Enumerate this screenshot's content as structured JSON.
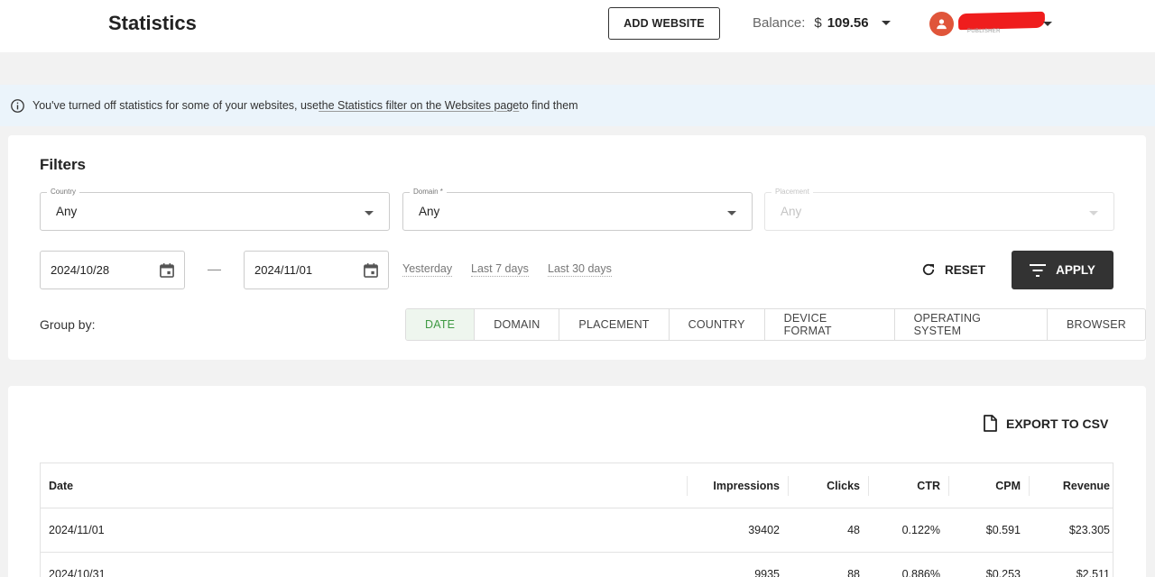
{
  "header": {
    "title": "Statistics",
    "add_website_label": "ADD WEBSITE",
    "balance_label": "Balance:",
    "balance_currency": "$",
    "balance_amount": "109.56",
    "account_role": "PUBLISHER",
    "avatar_color": "#e0553a"
  },
  "banner": {
    "text_before": "You've turned off statistics for some of your websites, use ",
    "link_text": "the Statistics filter on the Websites page",
    "text_after": " to find them"
  },
  "filters": {
    "title": "Filters",
    "country": {
      "label": "Country",
      "value": "Any"
    },
    "domain": {
      "label": "Domain *",
      "value": "Any"
    },
    "placement": {
      "label": "Placement",
      "value": "Any",
      "disabled": true
    },
    "date_from": "2024/10/28",
    "date_to": "2024/11/01",
    "quick_ranges": [
      "Yesterday",
      "Last 7 days",
      "Last 30 days"
    ],
    "reset_label": "RESET",
    "apply_label": "APPLY",
    "group_by_label": "Group by:",
    "group_by_options": [
      "DATE",
      "DOMAIN",
      "PLACEMENT",
      "COUNTRY",
      "DEVICE FORMAT",
      "OPERATING SYSTEM",
      "BROWSER"
    ],
    "group_by_selected": "DATE",
    "active_color": "#3f9a43"
  },
  "table": {
    "export_label": "EXPORT TO CSV",
    "columns": [
      "Date",
      "Impressions",
      "Clicks",
      "CTR",
      "CPM",
      "Revenue"
    ],
    "rows": [
      [
        "2024/11/01",
        "39402",
        "48",
        "0.122%",
        "$0.591",
        "$23.305"
      ],
      [
        "2024/10/31",
        "9935",
        "88",
        "0.886%",
        "$0.253",
        "$2.511"
      ]
    ]
  }
}
